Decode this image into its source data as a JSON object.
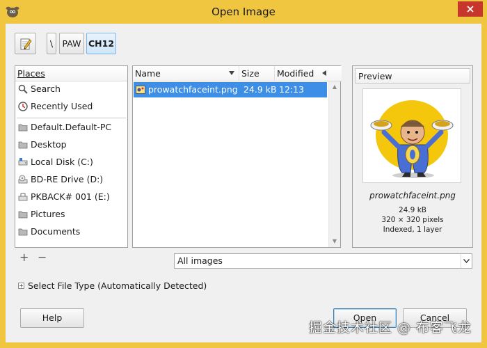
{
  "window": {
    "title": "Open Image",
    "title_color": "#f0c640"
  },
  "pathbar": {
    "edit_icon": "pencil-notepad-icon",
    "crumbs": [
      "\\",
      "PAW",
      "CH12"
    ],
    "active_crumb": "CH12"
  },
  "places": {
    "header": "Places",
    "items": [
      {
        "label": "Search",
        "icon": "search-icon"
      },
      {
        "label": "Recently Used",
        "icon": "clock-icon"
      },
      {
        "label": "Default.Default-PC",
        "icon": "folder-icon"
      },
      {
        "label": "Desktop",
        "icon": "folder-icon"
      },
      {
        "label": "Local Disk (C:)",
        "icon": "drive-icon"
      },
      {
        "label": "BD-RE Drive (D:)",
        "icon": "optical-drive-icon"
      },
      {
        "label": "PKBACK# 001 (E:)",
        "icon": "usb-drive-icon"
      },
      {
        "label": "Pictures",
        "icon": "folder-icon"
      },
      {
        "label": "Documents",
        "icon": "folder-icon"
      }
    ],
    "add_label": "+",
    "remove_label": "−"
  },
  "files": {
    "columns": {
      "name": "Name",
      "size": "Size",
      "modified": "Modified"
    },
    "rows": [
      {
        "name": "prowatchfaceint.png",
        "size": "24.9 kB",
        "modified": "12:13",
        "selected": true
      }
    ],
    "selection_color": "#3d8ee6"
  },
  "preview": {
    "header": "Preview",
    "filename": "prowatchfaceint.png",
    "size": "24.9 kB",
    "dimensions": "320 × 320 pixels",
    "mode": "Indexed, 1 layer"
  },
  "filter": {
    "value": "All images"
  },
  "filetype": {
    "expander": "+",
    "label": "Select File Type (Automatically Detected)"
  },
  "buttons": {
    "help": "Help",
    "open": "Open",
    "cancel": "Cancel"
  },
  "watermark": "掘金技术社区 @ 布客飞龙"
}
